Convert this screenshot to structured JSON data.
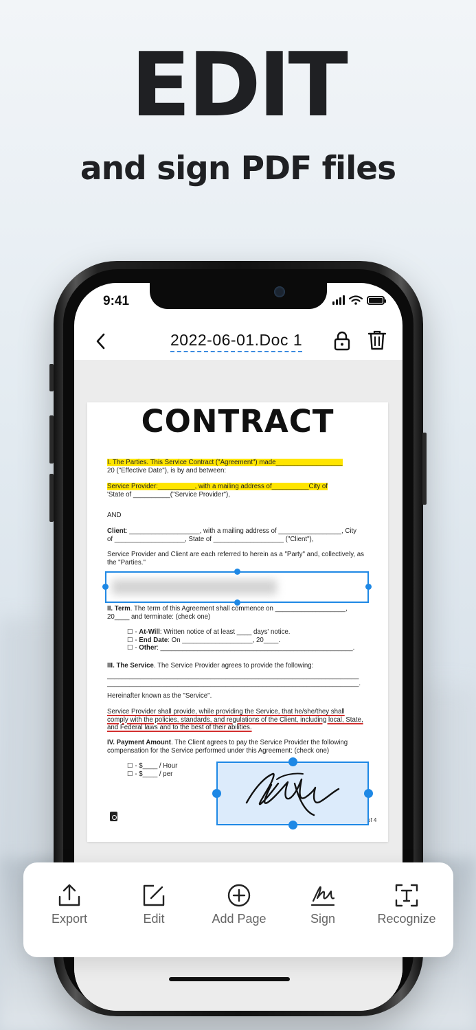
{
  "hero": {
    "title": "EDIT",
    "subtitle": "and sign PDF files"
  },
  "status_bar": {
    "time": "9:41"
  },
  "nav": {
    "title": "2022-06-01.Doc 1"
  },
  "document": {
    "heading": "CONTRACT",
    "p1_line1": "I. The Parties. This Service Contract (\"Agreement\") made__________________",
    "p1_line2": "20 (\"Effective Date\"), is by and between:",
    "p2_line1": "Service Provider:__________, with a mailing address of__________City of",
    "p2_line2": "'State of __________(\"Service Provider\"),",
    "and": "AND",
    "client_label": "Client",
    "client_line1": ": ___________________, with a mailing address of _________________, City",
    "client_line2": "of ___________________, State of ___________________ (\"Client\"),",
    "parties_line1": "Service Provider and Client are each referred to herein as a \"Party\" and, collectively, as",
    "parties_line2": "the \"Parties.\"",
    "term_label": "II. Term",
    "term_line1": ". The term of this Agreement shall commence on ___________________,",
    "term_line2": "20____ and terminate: (check one)",
    "at_will_label": "At-Will",
    "at_will_text": ": Written notice of at least ____ days' notice.",
    "end_date_label": "End Date",
    "end_date_text": ": On ___________________, 20____.",
    "other_label": "Other",
    "other_text": ": ____________________________________________________.",
    "service_label": "III. The Service",
    "service_text": ". The Service Provider agrees to provide the following:",
    "service_blank1": "____________________________________________________________________",
    "service_blank2": "____________________________________________________________________.",
    "hereinafter": "Hereinafter known as the \"Service\".",
    "sp_line1": "Service Provider shall provide, while providing the Service, that he/she/they shall",
    "sp_line2": "comply with the policies, standards, and regulations of the Client, including local, State,",
    "sp_line3": "and Federal laws and to the best of their abilities.",
    "pay_label": "IV. Payment Amount",
    "pay_line1": ". The Client agrees to pay the Service Provider the following",
    "pay_line2": "compensation for the Service performed under this Agreement: (check one)",
    "hour": "☐ - $____ / Hour",
    "per": "☐ - $____ / per",
    "checkbox": "☐ - ",
    "page_of": "of 4"
  },
  "toolbar": {
    "items": [
      {
        "label": "Export",
        "icon": "export-icon"
      },
      {
        "label": "Edit",
        "icon": "edit-icon"
      },
      {
        "label": "Add Page",
        "icon": "add-page-icon"
      },
      {
        "label": "Sign",
        "icon": "sign-icon"
      },
      {
        "label": "Recognize",
        "icon": "recognize-icon"
      }
    ]
  },
  "colors": {
    "accent": "#1e88e5",
    "highlight": "#ffe500",
    "underline": "#d32f2f"
  }
}
